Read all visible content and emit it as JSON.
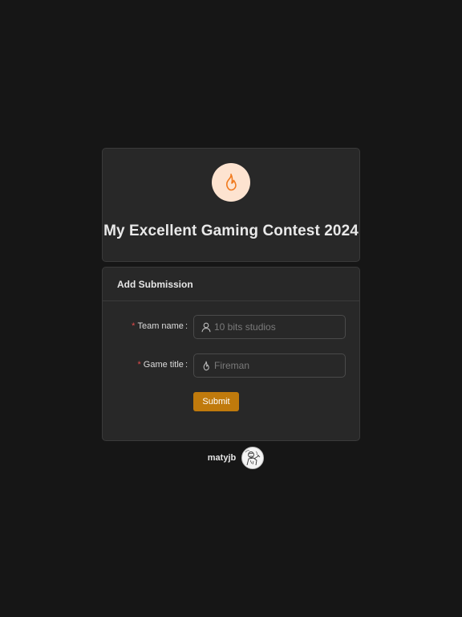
{
  "contest": {
    "title": "My Excellent Gaming Contest 2024",
    "logo_icon": "fire-icon",
    "logo_bg": "#fde3d0",
    "logo_color": "#f07a1e"
  },
  "form": {
    "header": "Add Submission",
    "required_mark": "*",
    "team_name": {
      "label": "Team name",
      "colon": ":",
      "placeholder": "10 bits studios",
      "icon": "user-icon"
    },
    "game_title": {
      "label": "Game title",
      "colon": ":",
      "placeholder": "Fireman",
      "icon": "fire-icon"
    },
    "submit_label": "Submit",
    "submit_color": "#c07a0c"
  },
  "footer": {
    "author": "matyjb",
    "avatar_icon": "avatar-sketch-image"
  }
}
